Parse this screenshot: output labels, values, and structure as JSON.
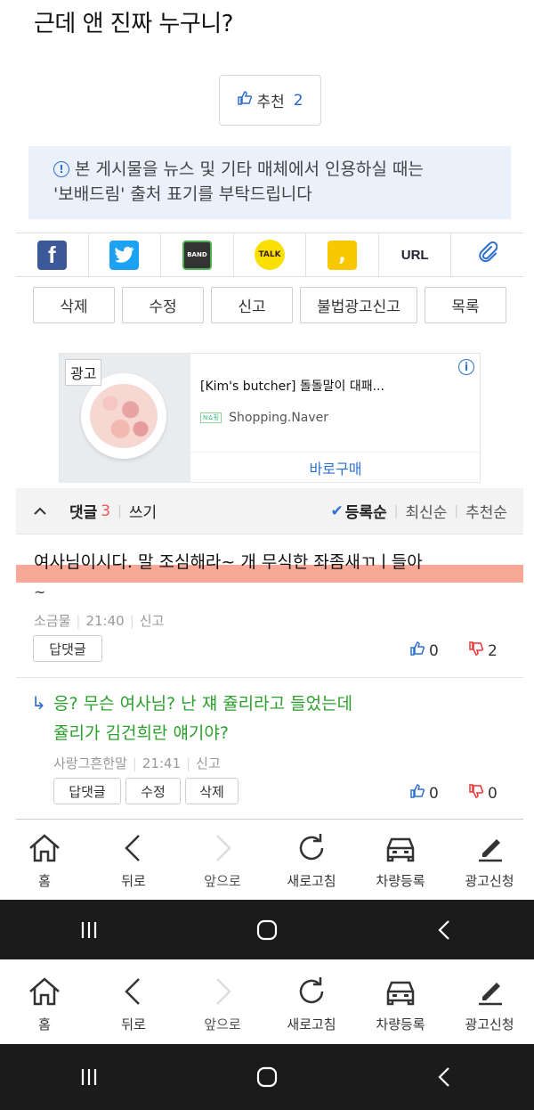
{
  "title": "근데 앤 진짜 누구니?",
  "recommend": {
    "label": "추천",
    "count": "2"
  },
  "notice": {
    "line1": "본 게시물을 뉴스 및 기타 매체에서 인용하실 때는",
    "line2": "'보배드림' 출처 표기를 부탁드립니다"
  },
  "share": {
    "url_label": "URL",
    "band_label": "BAND",
    "talk_label": "TALK"
  },
  "actions": [
    "삭제",
    "수정",
    "신고",
    "불법광고신고",
    "목록"
  ],
  "ad": {
    "label": "광고",
    "title": "[Kim's butcher] 돌돌말이 대패...",
    "source": "Shopping.Naver",
    "source_logo": "N쇼핑",
    "buy": "바로구매"
  },
  "comments_bar": {
    "label": "댓글",
    "count": "3",
    "write": "쓰기",
    "sort_active": "등록순",
    "sort_latest": "최신순",
    "sort_recommend": "추천순"
  },
  "comment1": {
    "text": "여사님이시다. 말 조심해라~ 개 무식한 좌좀새ㄲㅣ들아",
    "tail": "~",
    "author": "소금물",
    "time": "21:40",
    "report": "신고",
    "reply_btn": "답댓글",
    "up": "0",
    "down": "2"
  },
  "reply1": {
    "line1": "응? 무슨 여사님? 난 쟤 쥴리라고 들었는데",
    "line2": "쥴리가 김건희란 얘기야?",
    "author": "사랑그흔한말",
    "time": "21:41",
    "report": "신고",
    "reply_btn": "답댓글",
    "edit_btn": "수정",
    "delete_btn": "삭제",
    "up": "0",
    "down": "0"
  },
  "nav": {
    "home": "홈",
    "back": "뒤로",
    "forward": "앞으로",
    "refresh": "새로고침",
    "car": "차량등록",
    "ad": "광고신청"
  },
  "colors": {
    "accent": "#2f6fd0",
    "reply_green": "#2ca02c",
    "highlight": "#f7a896"
  }
}
